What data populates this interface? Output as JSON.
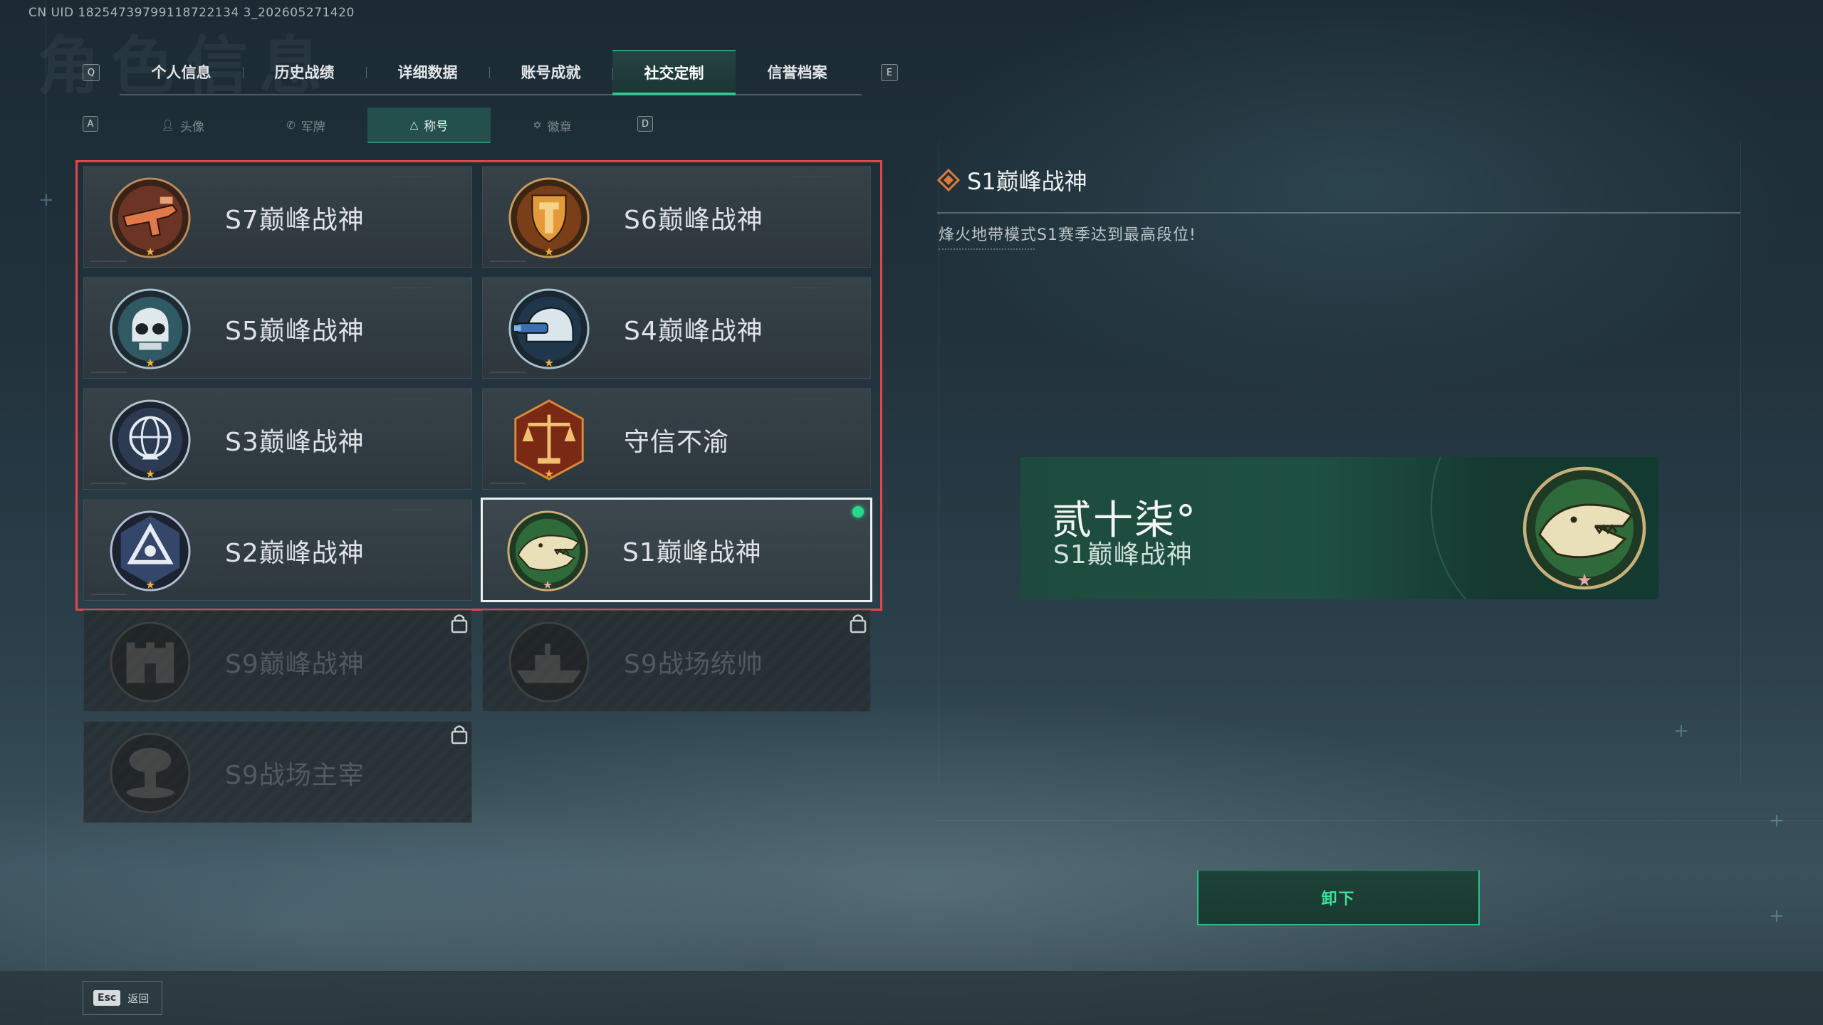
{
  "uid_text": "CN UID 18254739799118722134 3_202605271420",
  "watermark": "角色信息",
  "tabs": {
    "left_key": "Q",
    "right_key": "E",
    "items": [
      {
        "label": "个人信息"
      },
      {
        "label": "历史战绩"
      },
      {
        "label": "详细数据"
      },
      {
        "label": "账号成就"
      },
      {
        "label": "社交定制",
        "active": true
      },
      {
        "label": "信誉档案"
      }
    ]
  },
  "subtabs": {
    "left_key": "A",
    "right_key": "D",
    "items": [
      {
        "label": "头像",
        "icon": "person-icon"
      },
      {
        "label": "军牌",
        "icon": "dogtag-icon"
      },
      {
        "label": "称号",
        "icon": "title-icon",
        "active": true
      },
      {
        "label": "徽章",
        "icon": "medal-icon"
      }
    ]
  },
  "titles": [
    {
      "name": "S7巅峰战神",
      "badge": "rifle-badge-icon",
      "state": "owned"
    },
    {
      "name": "S6巅峰战神",
      "badge": "shield-t-badge-icon",
      "state": "owned"
    },
    {
      "name": "S5巅峰战神",
      "badge": "skull-mask-badge-icon",
      "state": "owned"
    },
    {
      "name": "S4巅峰战神",
      "badge": "night-vision-helmet-badge-icon",
      "state": "owned"
    },
    {
      "name": "S3巅峰战神",
      "badge": "globe-badge-icon",
      "state": "owned"
    },
    {
      "name": "守信不渝",
      "badge": "scales-badge-icon",
      "state": "owned"
    },
    {
      "name": "S2巅峰战神",
      "badge": "triangle-badge-icon",
      "state": "owned"
    },
    {
      "name": "S1巅峰战神",
      "badge": "crocodile-badge-icon",
      "state": "equipped"
    },
    {
      "name": "S9巅峰战神",
      "badge": "fortress-badge-icon",
      "state": "locked"
    },
    {
      "name": "S9战场统帅",
      "badge": "warship-badge-icon",
      "state": "locked"
    },
    {
      "name": "S9战场主宰",
      "badge": "mushroom-cloud-badge-icon",
      "state": "locked"
    }
  ],
  "detail": {
    "title": "S1巅峰战神",
    "description": "烽火地带模式S1赛季达到最高段位!"
  },
  "preview": {
    "player_name": "贰十柒°",
    "title": "S1巅峰战神",
    "badge": "crocodile-badge-icon"
  },
  "unequip_label": "卸下",
  "footer": {
    "esc_key": "Esc",
    "esc_label": "返回"
  },
  "colors": {
    "accent_green": "#2fc58d",
    "selection_frame": "#e5454a",
    "equipped_dot": "#27d88d"
  }
}
